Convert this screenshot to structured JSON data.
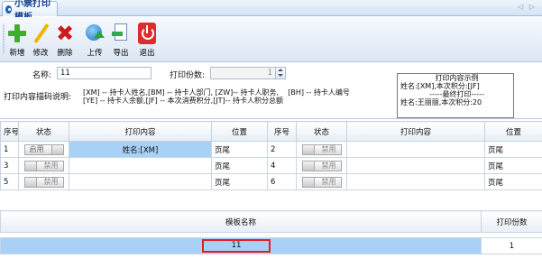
{
  "tab": {
    "title": "小票打印模板",
    "arrows": "◁ ▷"
  },
  "toolbar": {
    "add": "新增",
    "edit": "修改",
    "delete": "删除",
    "upload": "上传",
    "export": "导出",
    "exit": "退出"
  },
  "form": {
    "name_label": "名称:",
    "name_value": "11",
    "copies_label": "打印份数:",
    "copies_value": "1",
    "desc_label": "打印内容描码说明:",
    "desc_line1": "[XM] -- 持卡人姓名,[BM] -- 持卡人部门, [ZW]-- 持卡人职务,    [BH] -- 持卡人编号",
    "desc_line2": "[YE] -- 持卡人余额,[JF] -- 本次消费积分,[JT]-- 持卡人积分总额"
  },
  "sample": {
    "title": "打印内容示例",
    "line1": "姓名:[XM],本次积分:[JF]",
    "line2": "-----最终打印-----",
    "line3": "姓名:王丽丽,本次积分:20"
  },
  "grid": {
    "headers": [
      "序号",
      "状态",
      "打印内容",
      "位置",
      "序号",
      "状态",
      "打印内容",
      "位置"
    ],
    "rows": [
      {
        "l_no": "1",
        "l_state": "启用",
        "l_content": "姓名:[XM]",
        "l_pos": "页尾",
        "r_no": "2",
        "r_state": "禁用",
        "r_content": "",
        "r_pos": "页尾"
      },
      {
        "l_no": "3",
        "l_state": "禁用",
        "l_content": "",
        "l_pos": "页尾",
        "r_no": "4",
        "r_state": "禁用",
        "r_content": "",
        "r_pos": "页尾"
      },
      {
        "l_no": "5",
        "l_state": "禁用",
        "l_content": "",
        "l_pos": "页尾",
        "r_no": "6",
        "r_state": "禁用",
        "r_content": "",
        "r_pos": "页尾"
      }
    ]
  },
  "templates": {
    "headers": [
      "模板名称",
      "打印份数"
    ],
    "rows": [
      {
        "name": "11",
        "copies": "1"
      }
    ]
  },
  "colors": {
    "selection": "#a9d0f5",
    "highlight_box": "#e02020",
    "header_text": "#15428b"
  }
}
